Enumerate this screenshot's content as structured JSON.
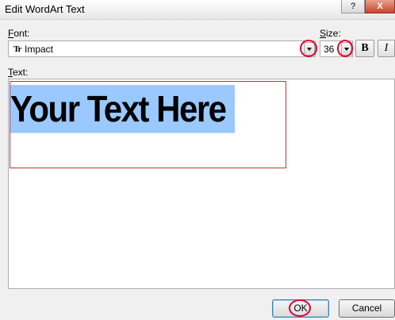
{
  "window": {
    "title": "Edit WordArt Text",
    "help_btn": "?",
    "close_btn": "X"
  },
  "font": {
    "label_prefix": "",
    "label_accel": "F",
    "label_rest": "ont:",
    "value": "Impact",
    "type_glyph": "Tr"
  },
  "size": {
    "label_accel": "S",
    "label_rest": "ize:",
    "value": "36"
  },
  "format": {
    "bold": "B",
    "italic": "I"
  },
  "text": {
    "label_accel": "T",
    "label_rest": "ext:",
    "content": "Your Text Here"
  },
  "buttons": {
    "ok": "OK",
    "cancel": "Cancel"
  },
  "colors": {
    "selection": "#99c9ff",
    "highlight_circle": "#e0002a"
  }
}
